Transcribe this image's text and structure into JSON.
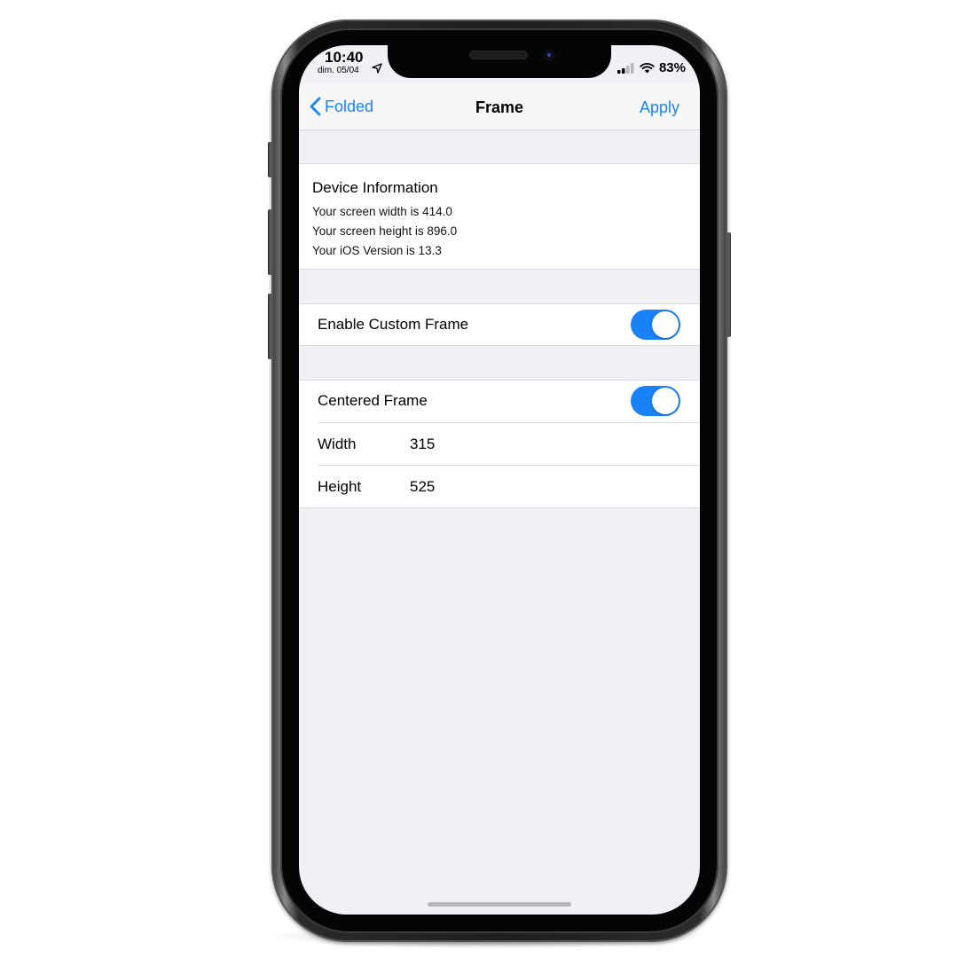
{
  "status_bar": {
    "time": "10:40",
    "date": "dim. 05/04",
    "battery": "83%"
  },
  "nav": {
    "back_label": "Folded",
    "title": "Frame",
    "apply_label": "Apply"
  },
  "device_info": {
    "title": "Device Information",
    "lines": [
      "Your screen width is 414.0",
      "Your screen height is 896.0",
      "Your iOS Version is 13.3"
    ]
  },
  "settings": {
    "enable_custom_frame": {
      "label": "Enable Custom Frame",
      "on": true
    },
    "centered_frame": {
      "label": "Centered Frame",
      "on": true
    },
    "width": {
      "label": "Width",
      "value": "315"
    },
    "height": {
      "label": "Height",
      "value": "525"
    }
  },
  "colors": {
    "accent": "#1a82f7",
    "background": "#f0f0f5"
  }
}
